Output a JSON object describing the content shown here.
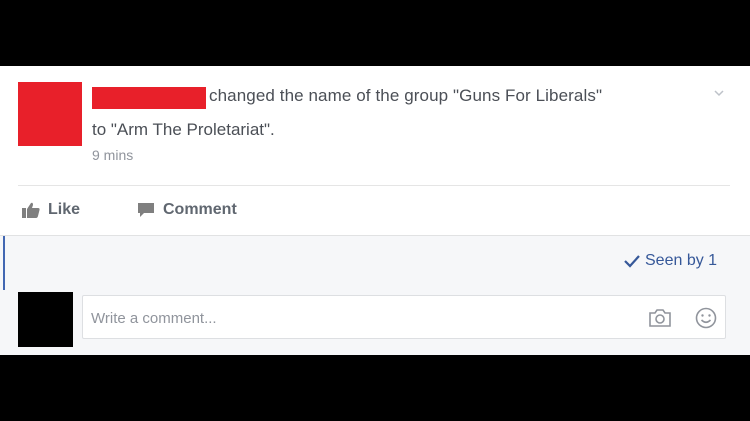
{
  "post": {
    "action_text_line1": "changed the name of the group \"Guns For Liberals\"",
    "action_text_line2": "to \"Arm The Proletariat\".",
    "time": "9 mins",
    "options_icon": "chevron-down-icon"
  },
  "actions": {
    "like_label": "Like",
    "like_icon": "thumbs-up-icon",
    "comment_label": "Comment",
    "comment_icon": "speech-bubble-icon"
  },
  "seen": {
    "label": "Seen by 1",
    "icon": "checkmark-icon"
  },
  "comment_box": {
    "placeholder": "Write a comment...",
    "camera_icon": "camera-icon",
    "emoji_icon": "smiley-icon"
  },
  "colors": {
    "redaction": "#e8202a",
    "link_blue": "#365899",
    "text_gray": "#4b4f56",
    "meta_gray": "#90949c"
  }
}
